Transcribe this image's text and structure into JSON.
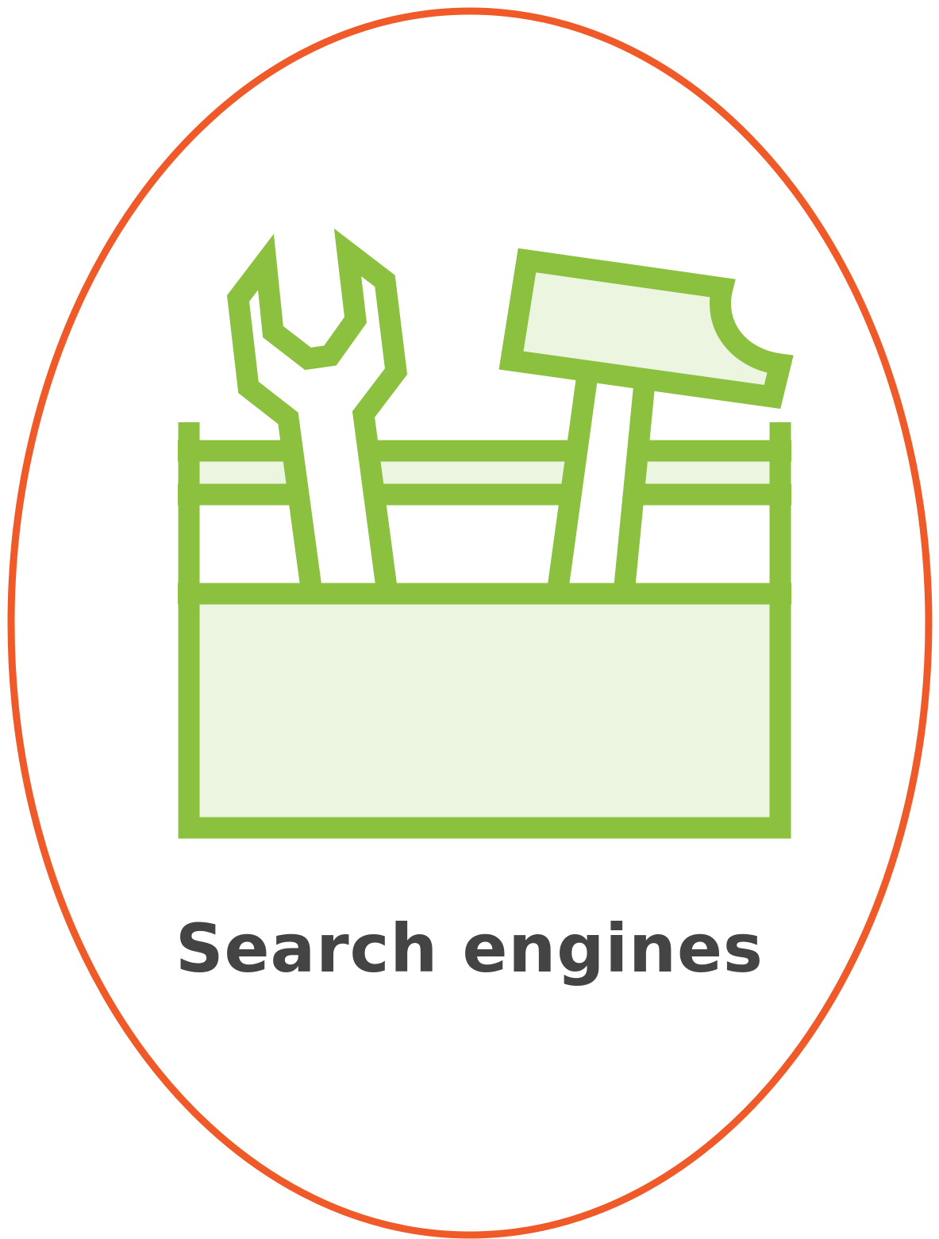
{
  "caption": "Search engines",
  "icon": "toolbox-icon",
  "colors": {
    "outline": "#f05a28",
    "stroke": "#8bc13f",
    "fill": "#ebf5e0",
    "text": "#444444",
    "background": "#ffffff"
  }
}
